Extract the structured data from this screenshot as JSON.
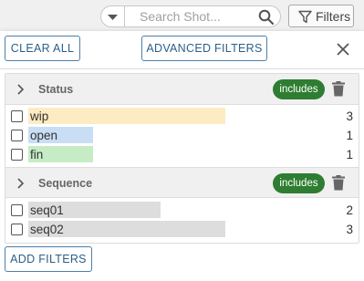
{
  "search": {
    "placeholder": "Search Shot..."
  },
  "toolbar": {
    "filters_label": "Filters"
  },
  "panel": {
    "clear_all": "CLEAR ALL",
    "advanced_filters": "ADVANCED FILTERS",
    "add_filters": "ADD FILTERS"
  },
  "groups": [
    {
      "name": "Status",
      "mode": "includes",
      "items": [
        {
          "label": "wip",
          "count": "3",
          "fraction": 1.0,
          "color": "#fdebc3"
        },
        {
          "label": "open",
          "count": "1",
          "fraction": 0.33,
          "color": "#c9def5"
        },
        {
          "label": "fin",
          "count": "1",
          "fraction": 0.33,
          "color": "#c6ecc6"
        }
      ]
    },
    {
      "name": "Sequence",
      "mode": "includes",
      "items": [
        {
          "label": "seq01",
          "count": "2",
          "fraction": 0.67,
          "color": "#dddddd"
        },
        {
          "label": "seq02",
          "count": "3",
          "fraction": 1.0,
          "color": "#dddddd"
        }
      ]
    }
  ],
  "colors": {
    "accent": "#2b5f8a",
    "pill": "#2e7d32"
  },
  "icons": [
    "chevron-down-icon",
    "search-icon",
    "filter-icon",
    "close-icon",
    "chevron-right-icon",
    "trash-icon"
  ]
}
